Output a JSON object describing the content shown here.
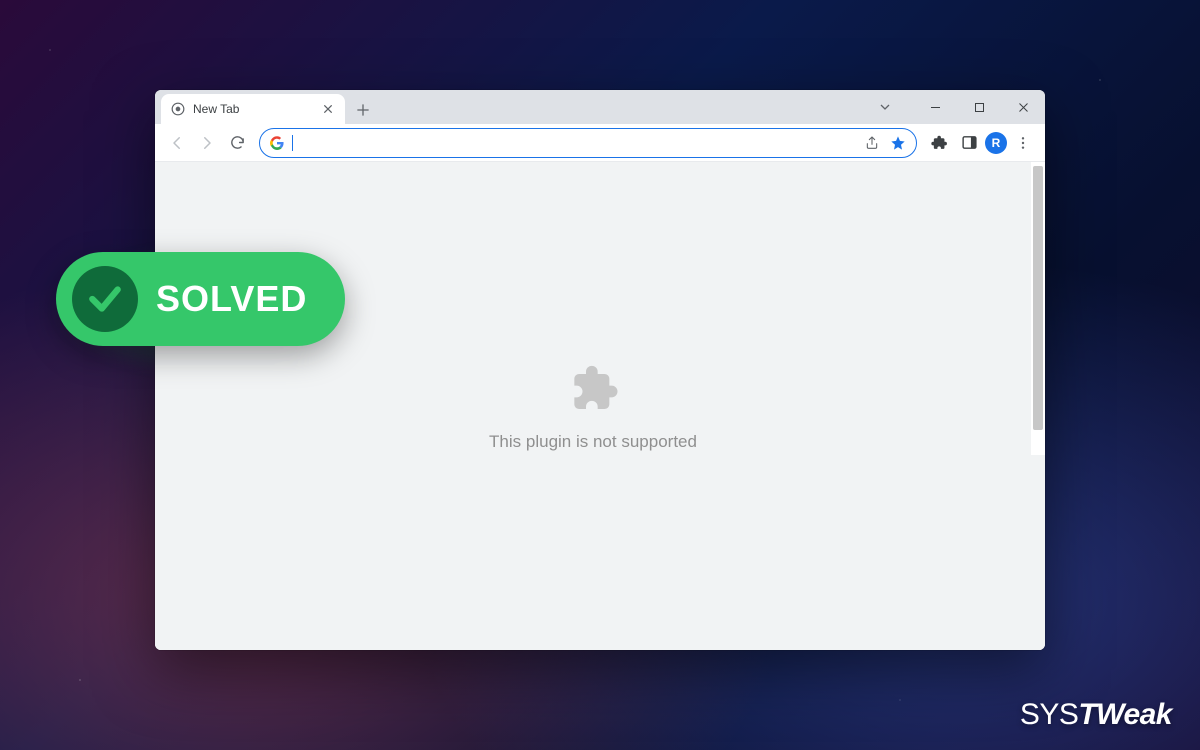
{
  "browser": {
    "tab": {
      "title": "New Tab"
    },
    "omnibox": {
      "value": "",
      "placeholder": ""
    },
    "profile_letter": "R"
  },
  "content": {
    "plugin_message": "This plugin is not supported"
  },
  "badge": {
    "label": "SOLVED"
  },
  "watermark": {
    "part1": "SYS",
    "part2": "TWeak"
  },
  "colors": {
    "accent_blue": "#1a73e8",
    "badge_green": "#35c76a",
    "badge_circle": "#0f6b3a"
  }
}
